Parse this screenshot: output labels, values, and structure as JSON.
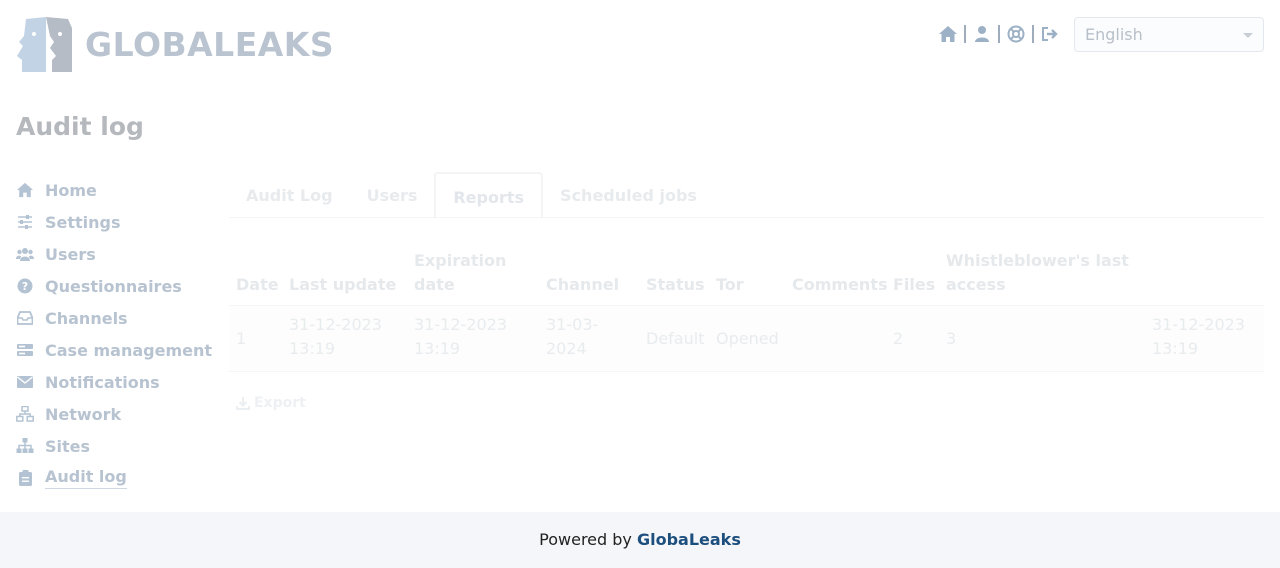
{
  "brand": {
    "name": "GLOBALEAKS"
  },
  "header": {
    "icons": [
      "home-icon",
      "user-icon",
      "help-icon",
      "logout-icon"
    ],
    "language": "English"
  },
  "page": {
    "title": "Audit log"
  },
  "sidebar": {
    "items": [
      {
        "label": "Home",
        "icon": "home-icon"
      },
      {
        "label": "Settings",
        "icon": "sliders-icon"
      },
      {
        "label": "Users",
        "icon": "users-icon"
      },
      {
        "label": "Questionnaires",
        "icon": "question-circle-icon"
      },
      {
        "label": "Channels",
        "icon": "inbox-icon"
      },
      {
        "label": "Case management",
        "icon": "case-icon"
      },
      {
        "label": "Notifications",
        "icon": "envelope-icon"
      },
      {
        "label": "Network",
        "icon": "network-icon"
      },
      {
        "label": "Sites",
        "icon": "sitemap-icon"
      },
      {
        "label": "Audit log",
        "icon": "clipboard-icon"
      }
    ],
    "active": "Audit log"
  },
  "tabs": {
    "items": [
      "Audit Log",
      "Users",
      "Reports",
      "Scheduled jobs"
    ],
    "active": "Reports"
  },
  "table": {
    "headers": {
      "date": "Date",
      "last_update_1": "Last update",
      "expiration_1": "Expiration",
      "expiration_2": "date",
      "channel": "Channel",
      "status": "Status",
      "tor": "Tor",
      "comments": "Comments",
      "files": "Files",
      "wb_1": "Whistleblower's last",
      "wb_2": "access"
    },
    "row": {
      "id": "1",
      "date_1": "31-12-2023",
      "date_2": "13:19",
      "last_update_1": "31-12-2023",
      "last_update_2": "13:19",
      "expiration_1": "31-03-",
      "expiration_2": "2024",
      "channel": "Default",
      "status": "Opened",
      "comments": "2",
      "files": "3",
      "wb_access_1": "31-12-2023",
      "wb_access_2": "13:19"
    }
  },
  "actions": {
    "export_label": "Export"
  },
  "footer": {
    "prefix": "Powered by",
    "link": "GlobaLeaks"
  },
  "colors": {
    "footer_link": "#1d4f7e",
    "logo": "#b9c4d0",
    "sidebar_text": "#b7c3d0"
  }
}
